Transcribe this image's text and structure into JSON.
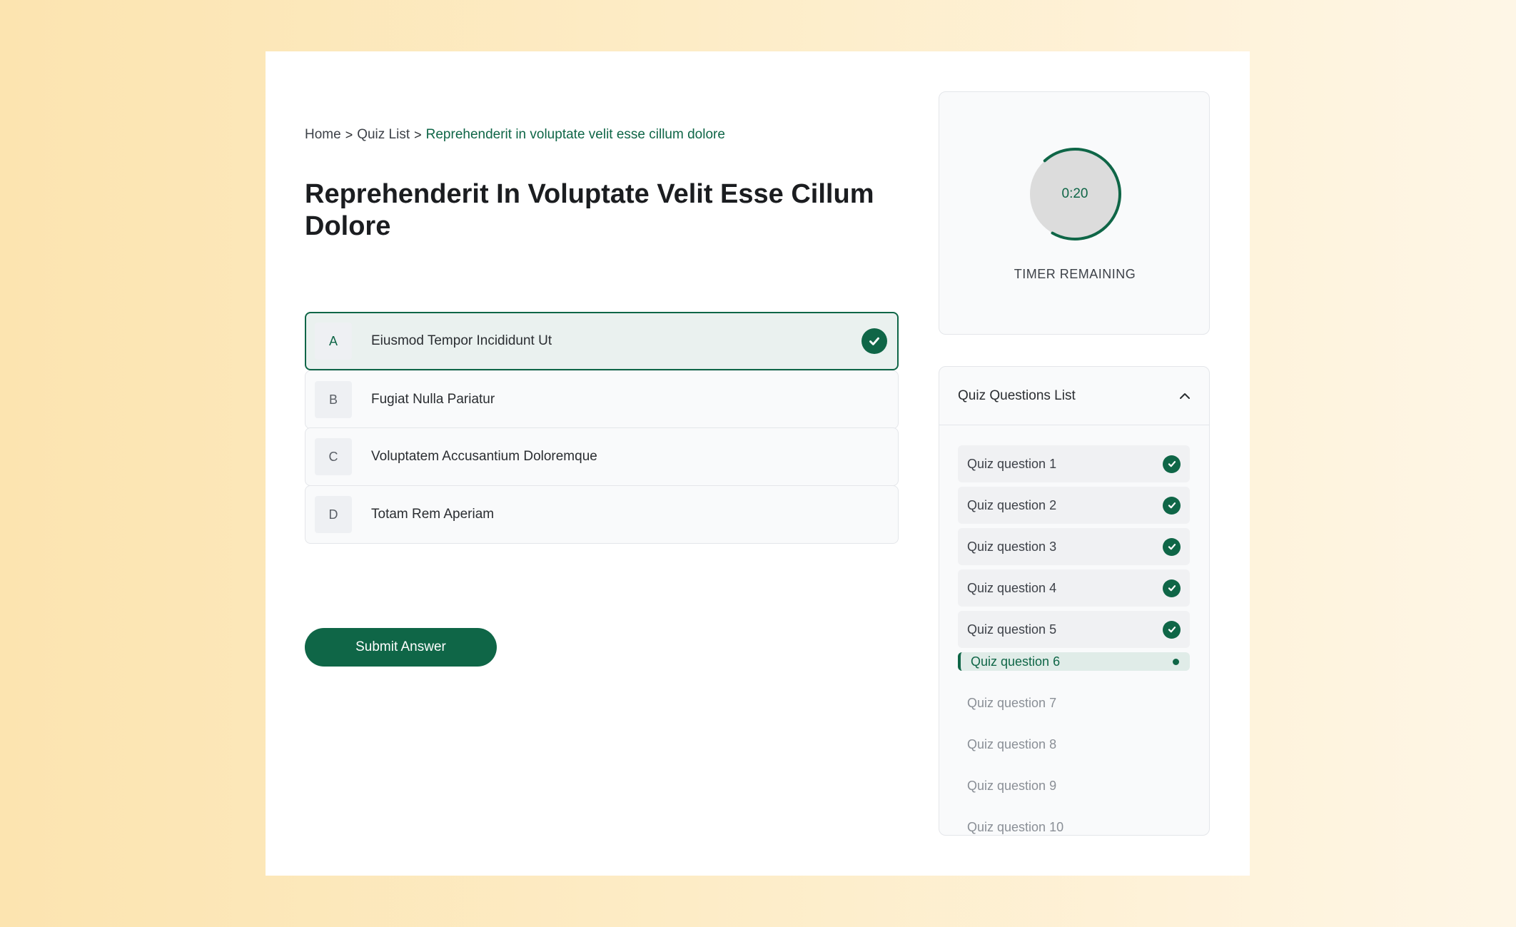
{
  "breadcrumb": {
    "home": "Home",
    "quiz_list": "Quiz List",
    "current": "Reprehenderit in voluptate velit esse cillum dolore"
  },
  "quiz": {
    "title": "Reprehenderit In Voluptate Velit Esse Cillum Dolore",
    "options": [
      {
        "letter": "A",
        "text": "Eiusmod Tempor Incididunt Ut",
        "selected": true
      },
      {
        "letter": "B",
        "text": "Fugiat Nulla Pariatur",
        "selected": false
      },
      {
        "letter": "C",
        "text": "Voluptatem Accusantium Doloremque",
        "selected": false
      },
      {
        "letter": "D",
        "text": "Totam Rem Aperiam",
        "selected": false
      }
    ],
    "submit_label": "Submit Answer"
  },
  "timer": {
    "value": "0:20",
    "label": "TIMER REMAINING",
    "progress_fraction": 0.7
  },
  "questions_list": {
    "title": "Quiz Questions List",
    "items": [
      {
        "label": "Quiz question 1",
        "status": "done"
      },
      {
        "label": "Quiz question 2",
        "status": "done"
      },
      {
        "label": "Quiz question 3",
        "status": "done"
      },
      {
        "label": "Quiz question 4",
        "status": "done"
      },
      {
        "label": "Quiz question 5",
        "status": "done"
      },
      {
        "label": "Quiz question 6",
        "status": "active"
      },
      {
        "label": "Quiz question 7",
        "status": "pending"
      },
      {
        "label": "Quiz question 8",
        "status": "pending"
      },
      {
        "label": "Quiz question 9",
        "status": "pending"
      },
      {
        "label": "Quiz question 10",
        "status": "pending"
      }
    ]
  },
  "colors": {
    "accent": "#0f6647",
    "accent_light": "#eaf1ef"
  },
  "icons": {
    "breadcrumb_separator": "chevron-right-icon",
    "selected_option": "check-circle-icon",
    "collapse": "chevron-up-icon",
    "question_done": "check-circle-icon",
    "question_active": "dot-icon"
  }
}
